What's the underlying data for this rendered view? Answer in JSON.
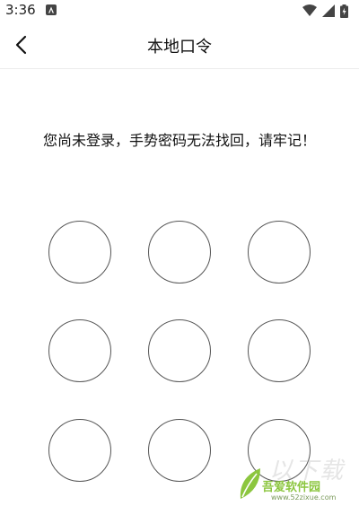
{
  "status_bar": {
    "time": "3:36"
  },
  "header": {
    "title": "本地口令"
  },
  "hint": "您尚未登录，手势密码无法找回，请牢记！",
  "pattern_grid": {
    "rows": 3,
    "cols": 3
  },
  "watermark": {
    "logo_text": "以下载",
    "name": "吾爱软件园",
    "url": "www.52zixue.com"
  },
  "colors": {
    "circle_stroke": "#555555",
    "text": "#111111",
    "background": "#ffffff"
  }
}
